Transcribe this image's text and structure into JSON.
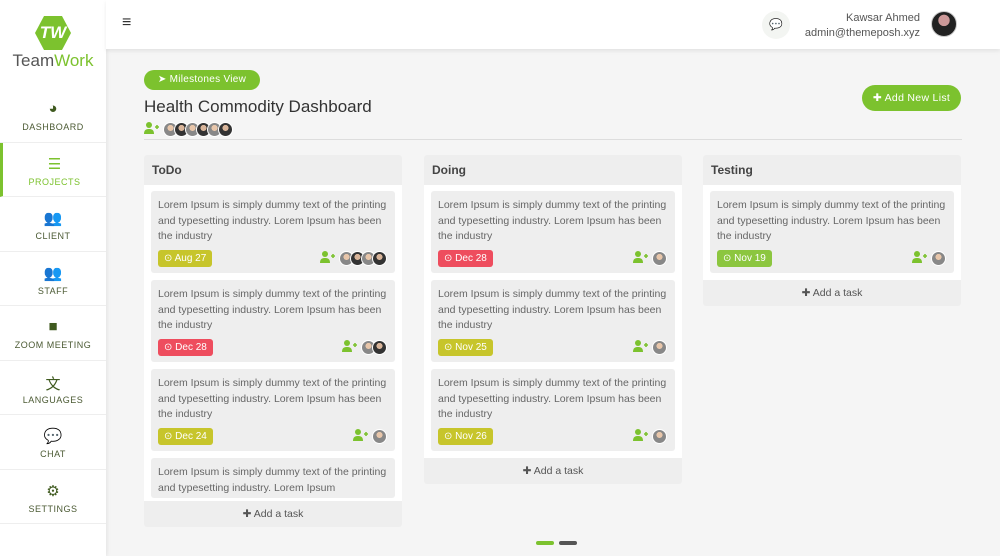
{
  "brand": {
    "mark": "TW",
    "name_a": "Team",
    "name_b": "Work"
  },
  "sidebar": {
    "items": [
      {
        "label": "DASHBOARD",
        "icon": "◕",
        "icon_name": "dashboard-icon"
      },
      {
        "label": "PROJECTS",
        "icon": "☰",
        "icon_name": "list-icon",
        "active": true
      },
      {
        "label": "CLIENT",
        "icon": "👥",
        "icon_name": "users-icon"
      },
      {
        "label": "STAFF",
        "icon": "👥",
        "icon_name": "users-icon"
      },
      {
        "label": "ZOOM MEETING",
        "icon": "■",
        "icon_name": "video-icon"
      },
      {
        "label": "LANGUAGES",
        "icon": "文",
        "icon_name": "language-icon"
      },
      {
        "label": "CHAT",
        "icon": "💬",
        "icon_name": "chat-icon"
      },
      {
        "label": "SETTINGS",
        "icon": "⚙",
        "icon_name": "cogs-icon"
      }
    ]
  },
  "topbar": {
    "menu": "≡",
    "chat": "💬",
    "user_name": "Kawsar Ahmed",
    "user_email": "admin@themeposh.xyz"
  },
  "page": {
    "milestones": "➤ Milestones View",
    "title": "Health Commodity Dashboard",
    "add_list": "✚ Add New List",
    "member_count": 6
  },
  "colors": {
    "accent": "#7cc22e",
    "yellow": "#c7c52b",
    "red": "#ee4d5e",
    "green": "#8cc63f"
  },
  "lists": [
    {
      "name": "ToDo",
      "add": "✚ Add a task",
      "cards": [
        {
          "text": "Lorem Ipsum is simply dummy text of the printing and typesetting industry. Lorem Ipsum has been the industry",
          "date": "⊙ Aug 27",
          "status": "yellow",
          "avatars": 4
        },
        {
          "text": "Lorem Ipsum is simply dummy text of the printing and typesetting industry. Lorem Ipsum has been the industry",
          "date": "⊙ Dec 28",
          "status": "red",
          "avatars": 2
        },
        {
          "text": "Lorem Ipsum is simply dummy text of the printing and typesetting industry. Lorem Ipsum has been the industry",
          "date": "⊙ Dec 24",
          "status": "yellow",
          "avatars": 1
        },
        {
          "text": "Lorem Ipsum is simply dummy text of the printing and typesetting industry. Lorem Ipsum",
          "date": "",
          "status": "yellow",
          "avatars": 0
        }
      ]
    },
    {
      "name": "Doing",
      "add": "✚ Add a task",
      "cards": [
        {
          "text": "Lorem Ipsum is simply dummy text of the printing and typesetting industry. Lorem Ipsum has been the industry",
          "date": "⊙ Dec 28",
          "status": "red",
          "avatars": 1
        },
        {
          "text": "Lorem Ipsum is simply dummy text of the printing and typesetting industry. Lorem Ipsum has been the industry",
          "date": "⊙ Nov 25",
          "status": "yellow",
          "avatars": 1
        },
        {
          "text": "Lorem Ipsum is simply dummy text of the printing and typesetting industry. Lorem Ipsum has been the industry",
          "date": "⊙ Nov 26",
          "status": "yellow",
          "avatars": 1
        }
      ]
    },
    {
      "name": "Testing",
      "add": "✚ Add a task",
      "cards": [
        {
          "text": "Lorem Ipsum is simply dummy text of the printing and typesetting industry. Lorem Ipsum has been the industry",
          "date": "⊙ Nov 19",
          "status": "green",
          "avatars": 1
        }
      ]
    }
  ]
}
